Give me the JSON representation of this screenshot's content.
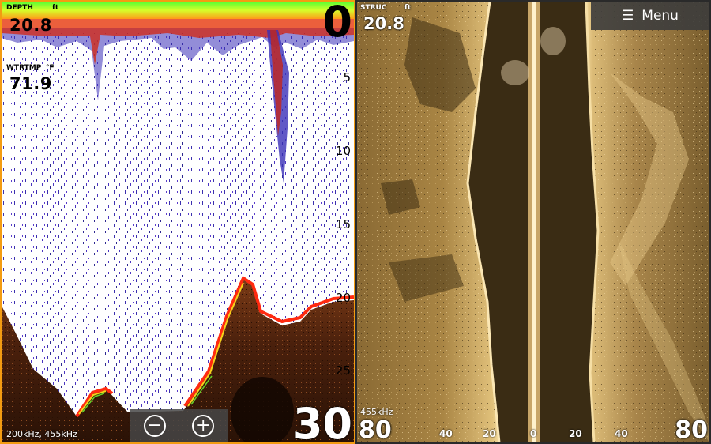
{
  "left_panel": {
    "depth_label": "DEPTH",
    "depth_unit": "ft",
    "depth_value": "20.8",
    "water_temp_label": "WTRTMP",
    "water_temp_unit": "°F",
    "water_temp_value": "71.9",
    "range_top": "0",
    "range_bottom": "30",
    "depth_ticks": [
      "5",
      "10",
      "15",
      "20",
      "25"
    ],
    "frequency": "200kHz, 455kHz",
    "zoom_out_label": "−",
    "zoom_in_label": "+"
  },
  "right_panel": {
    "menu_label": "Menu",
    "struc_label": "STRUC",
    "struc_unit": "ft",
    "struc_value": "20.8",
    "frequency": "455kHz",
    "range_left": "80",
    "range_right": "80",
    "scale_ticks": [
      "40",
      "20",
      "0",
      "20",
      "40"
    ]
  },
  "colors": {
    "pane_border": "#f39c12",
    "sonar_background": "#ffffff",
    "bottom_brown": "#5a2a10",
    "surface_green": "#39e639",
    "structure_tan": "#b8955a"
  },
  "icons": {
    "menu": "hamburger-icon",
    "zoom_out": "minus-circle-icon",
    "zoom_in": "plus-circle-icon"
  }
}
